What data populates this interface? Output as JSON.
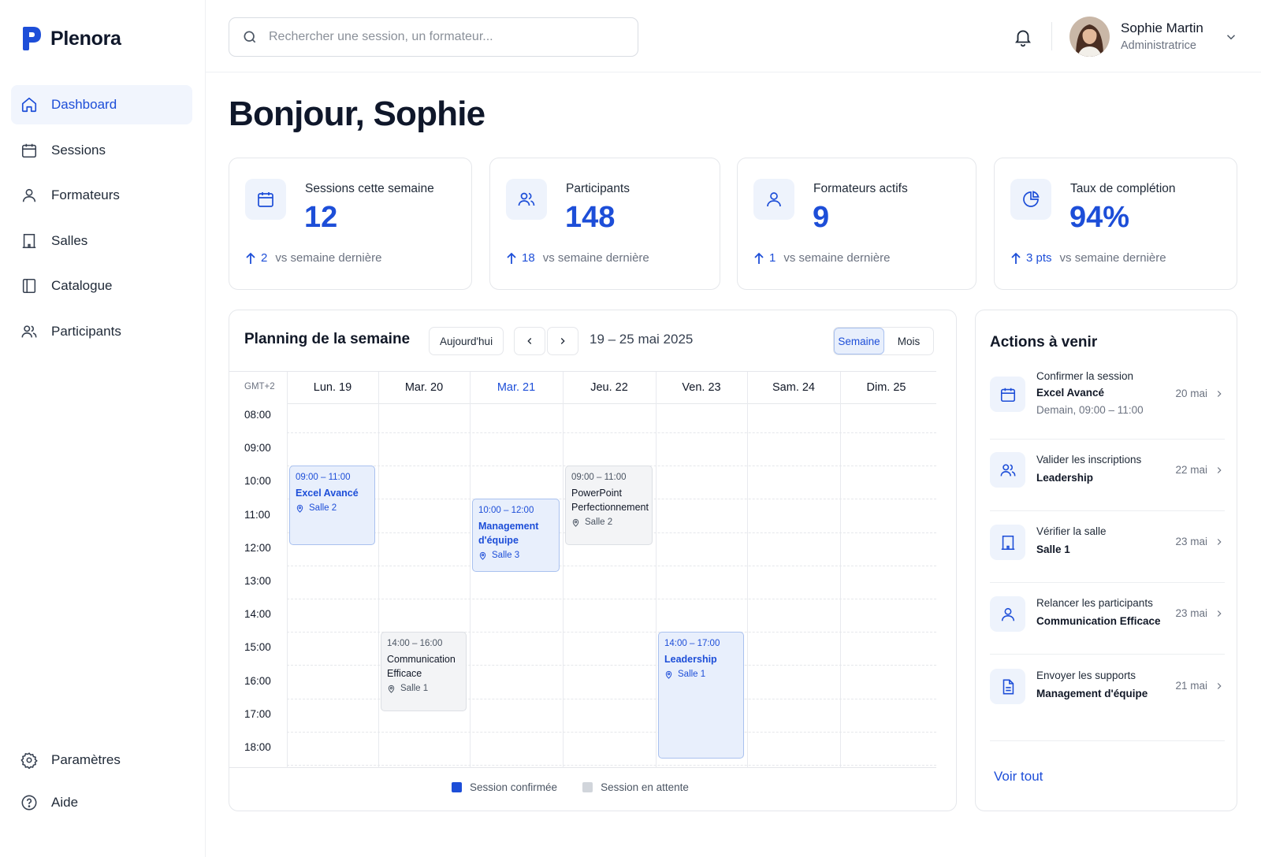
{
  "app": {
    "name": "Plenora"
  },
  "sidebar": {
    "items": [
      {
        "label": "Dashboard",
        "icon": "home-icon"
      },
      {
        "label": "Sessions",
        "icon": "calendar-icon"
      },
      {
        "label": "Formateurs",
        "icon": "user-icon"
      },
      {
        "label": "Salles",
        "icon": "building-icon"
      },
      {
        "label": "Catalogue",
        "icon": "book-icon"
      },
      {
        "label": "Participants",
        "icon": "users-icon"
      }
    ],
    "bottom": [
      {
        "label": "Paramètres",
        "icon": "gear-icon"
      },
      {
        "label": "Aide",
        "icon": "help-icon"
      }
    ],
    "active": "Dashboard"
  },
  "header": {
    "search_placeholder": "Rechercher une session, un formateur...",
    "user": {
      "name": "Sophie Martin",
      "role": "Administratrice"
    }
  },
  "greeting": "Bonjour, Sophie",
  "stats": [
    {
      "label": "Sessions cette semaine",
      "value": "12",
      "delta": "2",
      "comparison": "vs semaine dernière",
      "icon": "calendar-icon"
    },
    {
      "label": "Participants",
      "value": "148",
      "delta": "18",
      "comparison": "vs semaine dernière",
      "icon": "users-icon"
    },
    {
      "label": "Formateurs actifs",
      "value": "9",
      "delta": "1",
      "comparison": "vs semaine dernière",
      "icon": "user-icon"
    },
    {
      "label": "Taux de complétion",
      "value": "94%",
      "delta": "3 pts",
      "comparison": "vs semaine dernière",
      "icon": "pie-chart-icon"
    }
  ],
  "planning": {
    "title": "Planning de la semaine",
    "today_label": "Aujourd'hui",
    "range": "19 – 25 mai 2025",
    "view_options": [
      "Semaine",
      "Mois"
    ],
    "active_view": "Semaine",
    "timezone": "GMT+2",
    "days": [
      "Lun. 19",
      "Mar. 20",
      "Mar. 21",
      "Jeu. 22",
      "Ven. 23",
      "Sam. 24",
      "Dim. 25"
    ],
    "today_index": 2,
    "hours": [
      "08:00",
      "09:00",
      "10:00",
      "11:00",
      "12:00",
      "13:00",
      "14:00",
      "15:00",
      "16:00",
      "17:00",
      "18:00"
    ],
    "events": [
      {
        "time": "09:00 – 11:00",
        "title": "Excel Avancé",
        "room": "Salle 2",
        "status": "confirmed",
        "day": 0,
        "start": 9,
        "end": 11.4
      },
      {
        "time": "14:00 – 16:00",
        "title": "Communication Efficace",
        "room": "Salle 1",
        "status": "pending",
        "day": 1,
        "start": 14,
        "end": 16.4
      },
      {
        "time": "10:00 – 12:00",
        "title": "Management d'équipe",
        "room": "Salle 3",
        "status": "confirmed",
        "day": 2,
        "start": 10,
        "end": 12.2
      },
      {
        "time": "09:00 – 11:00",
        "title": "PowerPoint Perfectionnement",
        "room": "Salle 2",
        "status": "pending",
        "day": 3,
        "start": 9,
        "end": 11.4
      },
      {
        "time": "14:00 – 17:00",
        "title": "Leadership",
        "room": "Salle 1",
        "status": "confirmed",
        "day": 4,
        "start": 14,
        "end": 17.8
      }
    ],
    "legend": [
      {
        "label": "Session confirmée",
        "color": "#1d4ed8"
      },
      {
        "label": "Session en attente",
        "color": "#d1d5db"
      }
    ]
  },
  "actions": {
    "title": "Actions à venir",
    "items": [
      {
        "label": "Confirmer la session",
        "subject": "Excel Avancé",
        "meta": "Demain, 09:00 – 11:00",
        "date": "20 mai",
        "icon": "calendar-icon"
      },
      {
        "label": "Valider les inscriptions",
        "subject": "Leadership",
        "meta": "",
        "date": "22 mai",
        "icon": "users-icon"
      },
      {
        "label": "Vérifier la salle",
        "subject": "Salle 1",
        "meta": "",
        "date": "23 mai",
        "icon": "building-icon"
      },
      {
        "label": "Relancer les participants",
        "subject": "Communication Efficace",
        "meta": "",
        "date": "23 mai",
        "icon": "user-icon"
      },
      {
        "label": "Envoyer les supports",
        "subject": "Management d'équipe",
        "meta": "",
        "date": "21 mai",
        "icon": "document-icon"
      }
    ],
    "see_all": "Voir tout"
  },
  "colors": {
    "accent": "#1d4ed8",
    "accent_soft": "#e8effc",
    "pending": "#f3f4f6"
  }
}
